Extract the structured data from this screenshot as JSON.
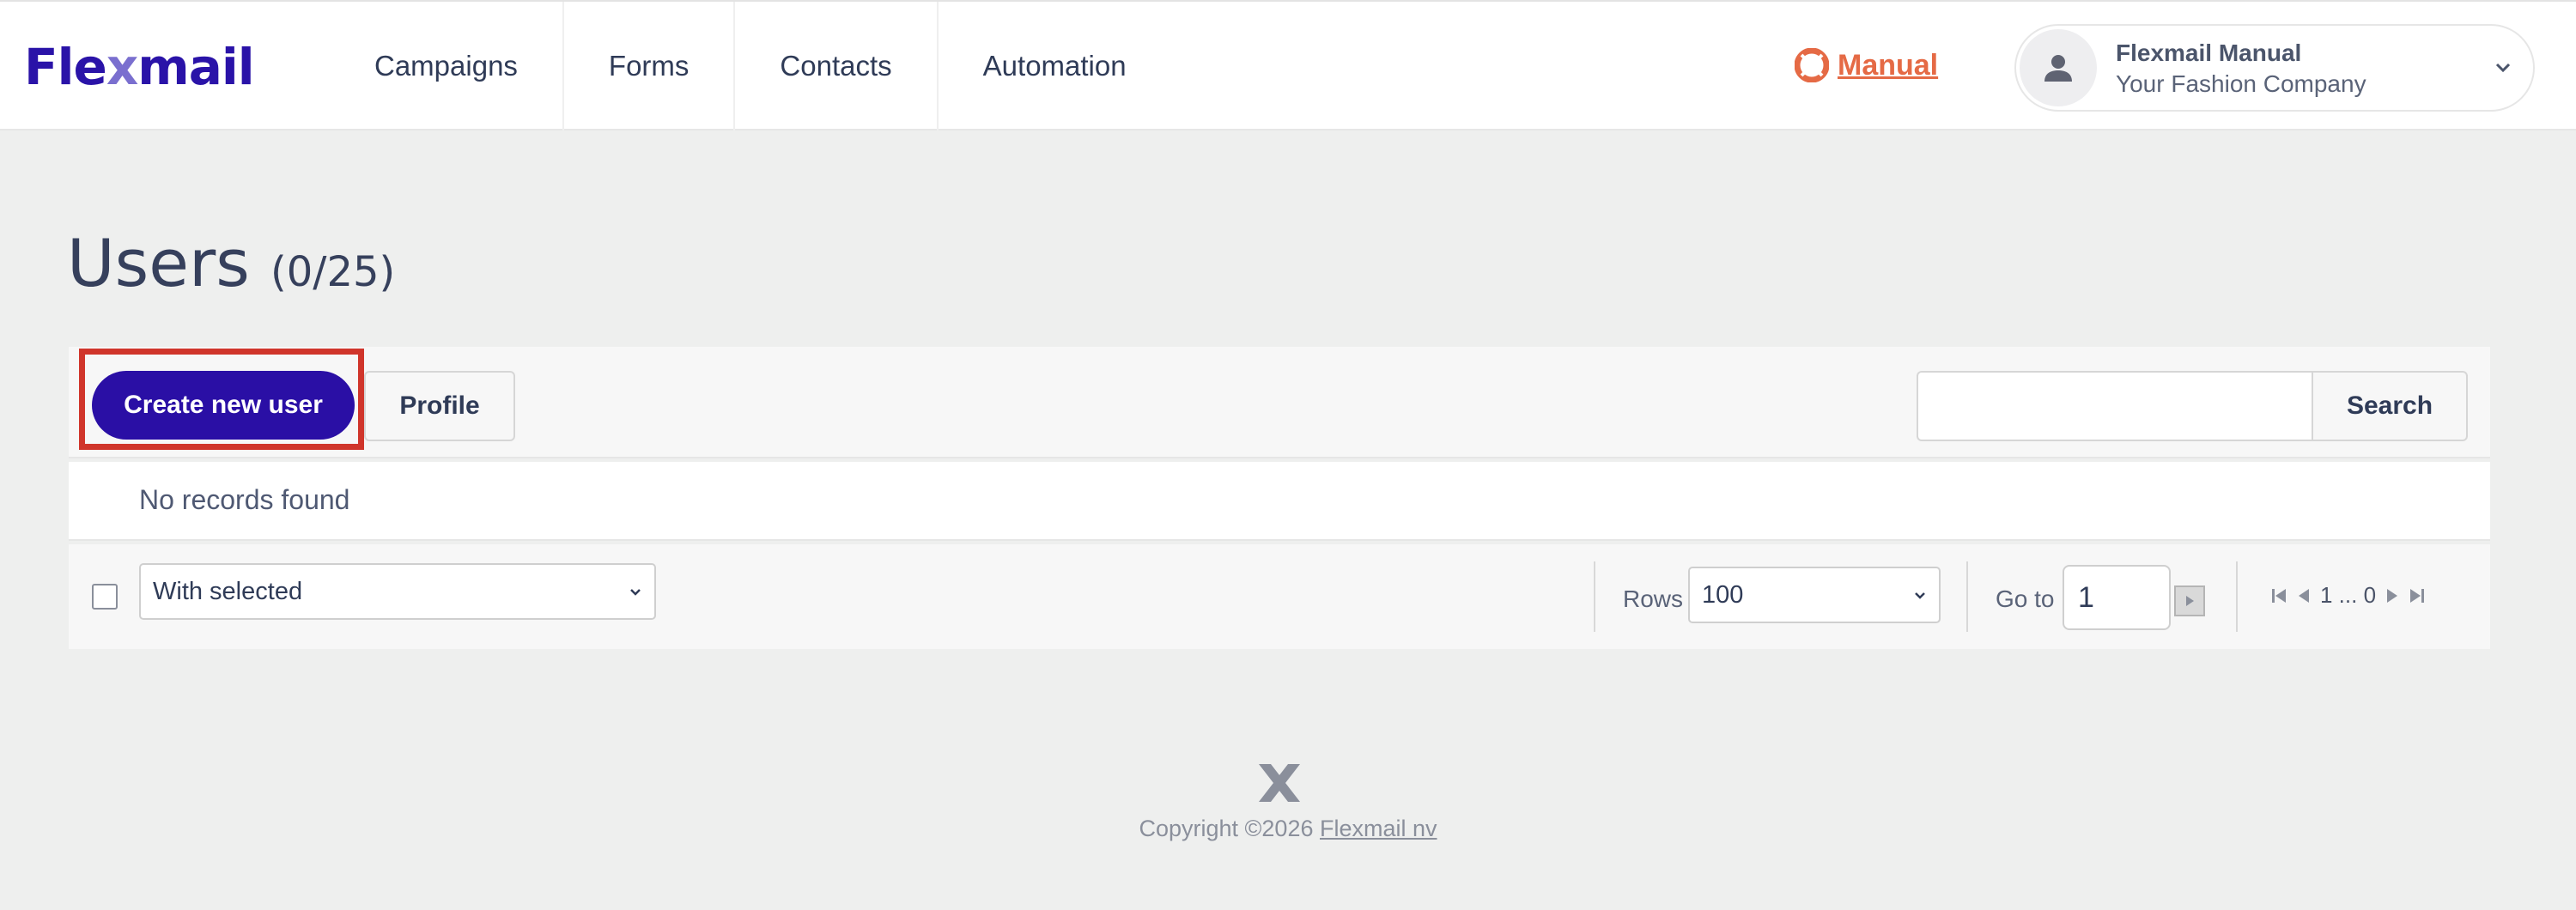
{
  "header": {
    "logo_prefix": "Fle",
    "logo_x": "x",
    "logo_suffix": "mail",
    "nav": [
      "Campaigns",
      "Forms",
      "Contacts",
      "Automation"
    ],
    "manual_label": "Manual",
    "account_name": "Flexmail Manual",
    "account_company": "Your Fashion Company"
  },
  "page": {
    "title": "Users",
    "count": "(0/25)"
  },
  "toolbar": {
    "create_label": "Create new user",
    "profile_label": "Profile",
    "search_value": "",
    "search_label": "Search"
  },
  "table": {
    "empty_message": "No records found"
  },
  "footerbar": {
    "bulk_action": "With selected",
    "rows_label": "Rows",
    "rows_value": "100",
    "goto_label": "Go to",
    "goto_value": "1",
    "pager_text": "1 ... 0"
  },
  "footer": {
    "copyright_prefix": "Copyright ©2026 ",
    "company_link": "Flexmail nv"
  },
  "colors": {
    "brand": "#2a0fa5",
    "manual_accent": "#e56a45",
    "highlight": "#d0352b"
  }
}
